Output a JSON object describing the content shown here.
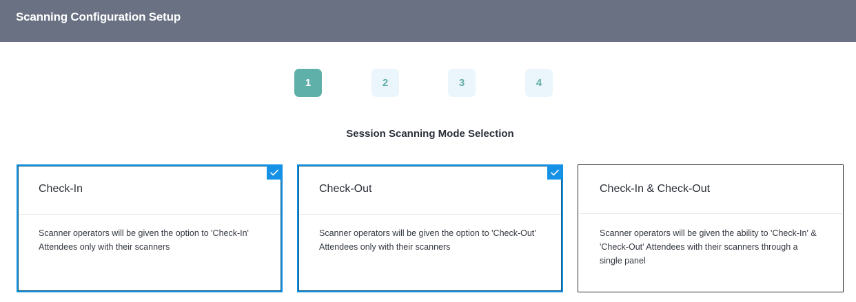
{
  "header": {
    "title": "Scanning Configuration Setup"
  },
  "steps": [
    {
      "label": "1",
      "active": true
    },
    {
      "label": "2",
      "active": false
    },
    {
      "label": "3",
      "active": false
    },
    {
      "label": "4",
      "active": false
    }
  ],
  "section": {
    "title": "Session Scanning Mode Selection"
  },
  "cards": [
    {
      "title": "Check-In",
      "description": "Scanner operators will be given the option to 'Check-In' Attendees only with their scanners",
      "selected": true
    },
    {
      "title": "Check-Out",
      "description": "Scanner operators will be given the option to 'Check-Out' Attendees only with their scanners",
      "selected": true
    },
    {
      "title": "Check-In & Check-Out",
      "description": "Scanner operators will be given the ability to 'Check-In' & 'Check-Out' Attendees with their scanners through a single panel",
      "selected": false
    }
  ],
  "colors": {
    "header_bg": "#697183",
    "step_active": "#5eb0a8",
    "step_inactive": "#eaf6fb",
    "selected_border": "#0f8fe0",
    "check_badge": "#1592e6"
  },
  "icons": {
    "check": "checkmark-icon"
  }
}
